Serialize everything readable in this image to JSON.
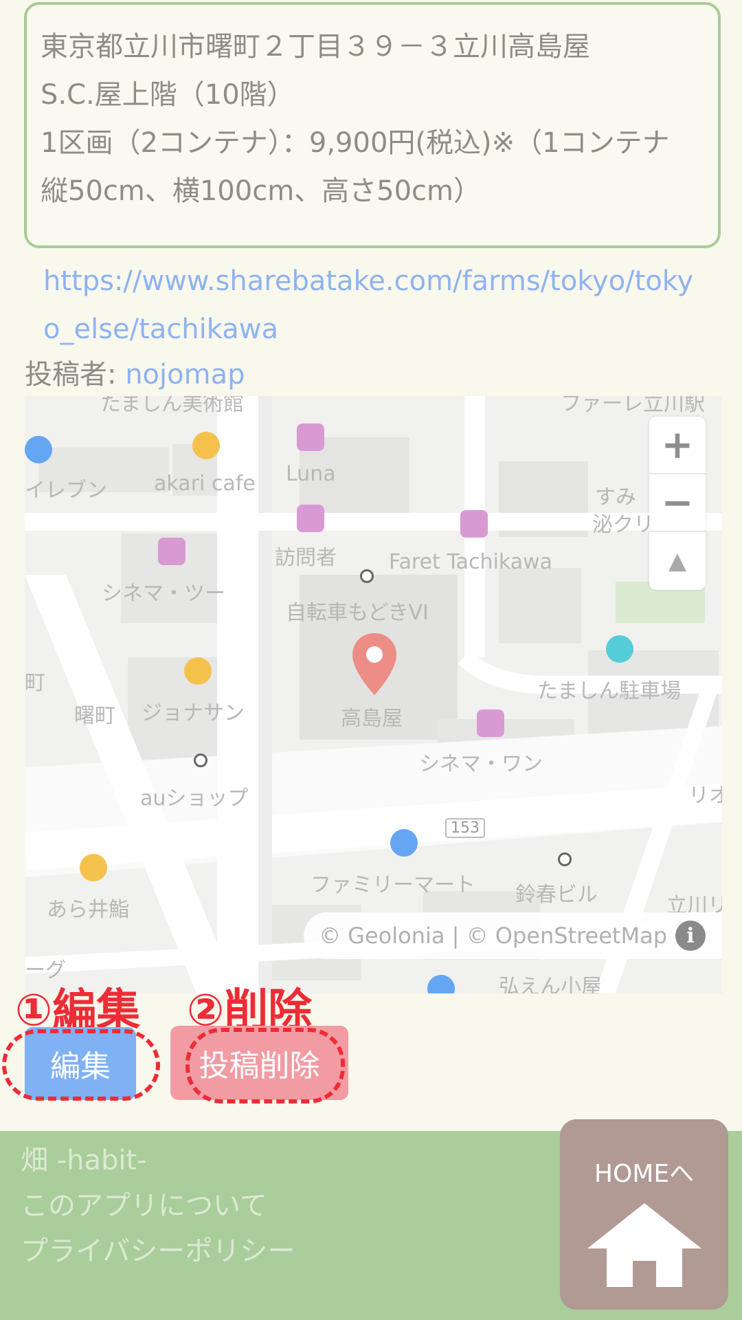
{
  "detail": {
    "lines": [
      "東京都立川市曙町２丁目３９－３立川高島屋",
      "S.C.屋上階（10階）",
      "1区画（2コンテナ）：9,900円(税込)※（1コンテナ",
      "縦50cm、横100cm、高さ50cm）"
    ]
  },
  "url": {
    "text": "https://www.sharebatake.com/farms/tokyo/tokyo_else/tachikawa"
  },
  "poster": {
    "label": "投稿者: ",
    "name": "nojomap"
  },
  "map": {
    "labels": {
      "top_museum": "たましん美術館",
      "top_right": "ファーレ立川駅",
      "seven": "イレブン",
      "akari": "akari cafe",
      "luna": "Luna",
      "sumi": "すみ",
      "clinic": "泌クリ",
      "houmon": "訪問者",
      "faret": "Faret Tachikawa",
      "cinema2": "シネマ・ツー",
      "bike": "自転車もどきVI",
      "akebono_left": "町",
      "akebono": "曙町",
      "jonathan": "ジョナサン",
      "takashimaya": "高島屋",
      "tamashin_parking": "たましん駐車場",
      "cinema1": "シネマ・ワン",
      "au": "auショップ",
      "rio": "リオ",
      "route": "153",
      "familymart": "ファミリーマート",
      "suzuharu": "鈴春ビル",
      "arai": "あら井鮨",
      "tachikawa_r": "立川リ",
      "left_g": "ーグ",
      "bottom": "弘えん小屋"
    },
    "zoom_in": "+",
    "zoom_out": "−",
    "compass": "▲",
    "attribution": "© Geolonia | © OpenStreetMap",
    "info": "i"
  },
  "annotations": {
    "edit": "①編集",
    "delete": "②削除"
  },
  "buttons": {
    "edit": "編集",
    "delete": "投稿削除"
  },
  "footer": {
    "links": [
      "畑 -habit-",
      "このアプリについて",
      "プライバシーポリシー"
    ],
    "home_label": "HOMEへ"
  },
  "colors": {
    "background": "#f8f8ed",
    "box_border": "#a8cc95",
    "link": "#8fb2f0",
    "edit_button": "#7fb1f4",
    "delete_button": "#f29ba3",
    "annotation": "#ee2c36",
    "footer": "#a9cd9b",
    "home_button": "#b19994"
  }
}
